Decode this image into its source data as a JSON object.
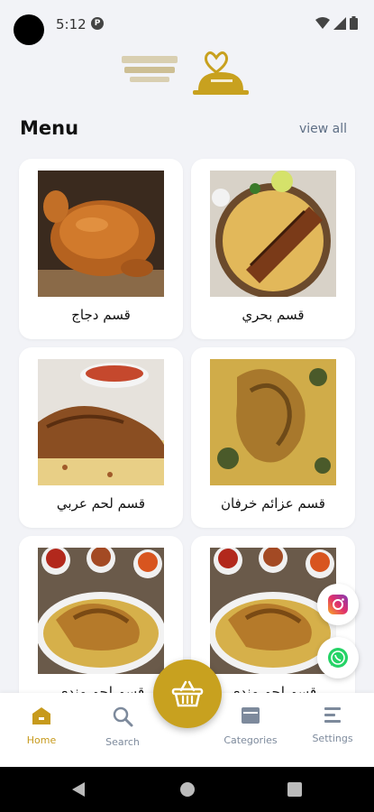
{
  "status": {
    "time": "5:12",
    "badge": "P"
  },
  "header": {
    "menu_title": "Menu",
    "view_all": "view all"
  },
  "cards": [
    {
      "label": "قسم دجاج",
      "image": "roast-chicken"
    },
    {
      "label": "قسم بحري",
      "image": "fish-rice"
    },
    {
      "label": "قسم لحم عربي",
      "image": "lamb-rice"
    },
    {
      "label": "قسم عزائم خرفان",
      "image": "whole-lamb-rice"
    },
    {
      "label": "قسم لحم مندي",
      "image": "lamb-mandi"
    },
    {
      "label": "قسم لحم مندي",
      "image": "lamb-mandi"
    }
  ],
  "social": {
    "instagram": "instagram-icon",
    "whatsapp": "whatsapp-icon"
  },
  "nav": {
    "home": "Home",
    "search": "Search",
    "categories": "Categories",
    "settings": "Settings"
  },
  "colors": {
    "accent": "#c8a11f",
    "background": "#f2f3f7",
    "nav_inactive": "#7d8a9c"
  }
}
